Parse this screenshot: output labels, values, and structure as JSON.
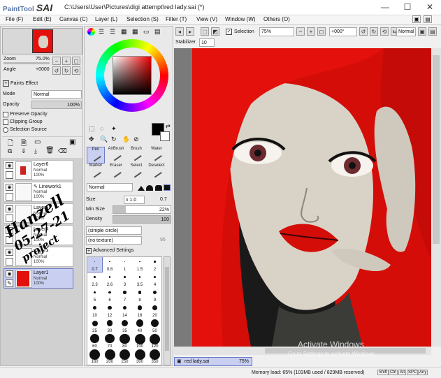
{
  "app": {
    "logo_small": "PaintTool",
    "logo_big": "SAI",
    "title": "C:\\Users\\User\\Pictures\\digi attempt\\red lady.sai (*)"
  },
  "window_controls": {
    "minimize": "—",
    "maximize": "☐",
    "close": "✕"
  },
  "menu": [
    "File (F)",
    "Edit (E)",
    "Canvas (C)",
    "Layer (L)",
    "Selection (S)",
    "Filter (T)",
    "View (V)",
    "Window (W)",
    "Others (O)"
  ],
  "navigator": {
    "zoom_label": "Zoom",
    "zoom_value": "75.0%",
    "angle_label": "Angle",
    "angle_value": "+0000"
  },
  "paints_effect": "Paints Effect",
  "layer_props": {
    "mode_label": "Mode",
    "mode_value": "Normal",
    "opacity_label": "Opacity",
    "opacity_value": "100%",
    "preserve_opacity": "Preserve Opacity",
    "clipping_group": "Clipping Group",
    "selection_source": "Selection Source"
  },
  "layers": [
    {
      "name": "Layer6",
      "mode": "Normal",
      "opacity": "100%"
    },
    {
      "name": "Linework1",
      "mode": "Normal",
      "opacity": "100%"
    },
    {
      "name": "Layer5",
      "mode": "Normal",
      "opacity": "100%"
    },
    {
      "name": "Layer4",
      "mode": "Normal",
      "opacity": "100%"
    },
    {
      "name": "Layer3",
      "mode": "Normal",
      "opacity": "100%"
    },
    {
      "name": "Layer1",
      "mode": "Normal",
      "opacity": "100%"
    }
  ],
  "tools": [
    "Pen",
    "AirBrush",
    "Brush",
    "Water",
    "Marker",
    "Eraser",
    "Select",
    "Deselect"
  ],
  "brush": {
    "mode": "Normal",
    "size_label": "Size",
    "size_mult": "x 1.0",
    "size_value": "0.7",
    "min_size_label": "Min Size",
    "min_size_value": "22%",
    "density_label": "Density",
    "density_value": "100",
    "simple_circle": "(simple circle)",
    "no_texture": "(no texture)",
    "tex_value": "95",
    "advanced": "Advanced Settings"
  },
  "brush_sizes": [
    "0.7",
    "0.8",
    "1",
    "1.5",
    "2",
    "2.3",
    "2.6",
    "3",
    "3.5",
    "4",
    "5",
    "6",
    "7",
    "8",
    "9",
    "10",
    "12",
    "14",
    "16",
    "20",
    "25",
    "30",
    "35",
    "40",
    "50",
    "60",
    "70",
    "80",
    "100",
    "120",
    "160",
    "200",
    "250",
    "300",
    "350"
  ],
  "canvas_toolbar": {
    "selection_label": "Selection",
    "zoom": "75%",
    "angle": "+000°",
    "blend": "Normal"
  },
  "stabilizer": {
    "label": "Stabilizer",
    "value": "10"
  },
  "canvas_tab": {
    "name": "red lady.sai",
    "zoom": "75%"
  },
  "watermark": {
    "line1": "Activate Windows",
    "line2": "Go to Settings to activate Windows."
  },
  "handwriting": {
    "line1": "Hanzell",
    "line2": "05-27-21",
    "line3": "project"
  },
  "status": {
    "memory": "Memory load: 65% (103MB used / 829MB reserved)",
    "keys": [
      "Shift",
      "Ctrl",
      "Alt",
      "SPC",
      "Any"
    ]
  },
  "colors": {
    "hair": "#e3100c",
    "skin": "#d9d2c6",
    "panel": "#e9e9e9",
    "accent": "#9aa7dd"
  }
}
